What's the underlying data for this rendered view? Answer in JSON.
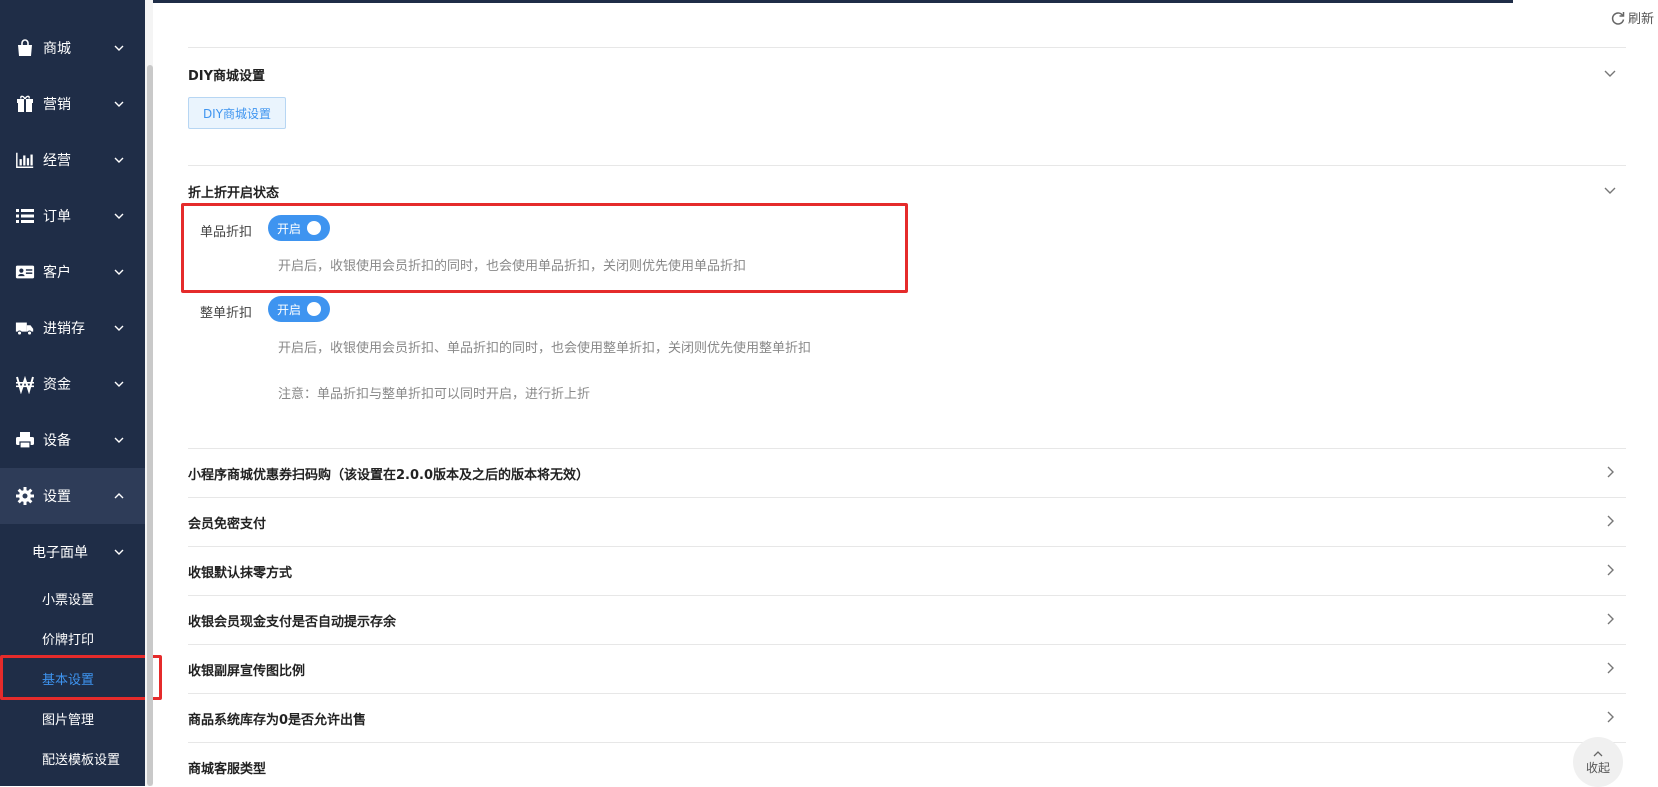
{
  "refresh_label": "刷新",
  "nav": {
    "items": [
      {
        "label": "商城",
        "icon": "shopping-bag-icon"
      },
      {
        "label": "营销",
        "icon": "gift-icon"
      },
      {
        "label": "经营",
        "icon": "bar-chart-icon"
      },
      {
        "label": "订单",
        "icon": "list-icon"
      },
      {
        "label": "客户",
        "icon": "id-card-icon"
      },
      {
        "label": "进销存",
        "icon": "truck-icon"
      },
      {
        "label": "资金",
        "icon": "won-icon"
      },
      {
        "label": "设备",
        "icon": "printer-icon"
      },
      {
        "label": "设置",
        "icon": "gear-icon"
      }
    ],
    "subgroup": "电子面单",
    "subitems": [
      "小票设置",
      "价牌打印",
      "基本设置",
      "图片管理",
      "配送模板设置"
    ]
  },
  "sections": {
    "diy": {
      "title": "DIY商城设置",
      "button": "DIY商城设置"
    },
    "discount": {
      "title": "折上折开启状态",
      "single": {
        "label": "单品折扣",
        "toggle": "开启",
        "hint": "开启后，收银使用会员折扣的同时，也会使用单品折扣，关闭则优先使用单品折扣"
      },
      "whole": {
        "label": "整单折扣",
        "toggle": "开启",
        "hint": "开启后，收银使用会员折扣、单品折扣的同时，也会使用整单折扣，关闭则优先使用整单折扣"
      },
      "note": "注意：单品折扣与整单折扣可以同时开启，进行折上折"
    }
  },
  "rows": [
    "小程序商城优惠券扫码购（该设置在2.0.0版本及之后的版本将无效）",
    "会员免密支付",
    "收银默认抹零方式",
    "收银会员现金支付是否自动提示存余",
    "收银副屏宣传图比例",
    "商品系统库存为0是否允许出售",
    "商城客服类型"
  ],
  "collapse_label": "收起"
}
